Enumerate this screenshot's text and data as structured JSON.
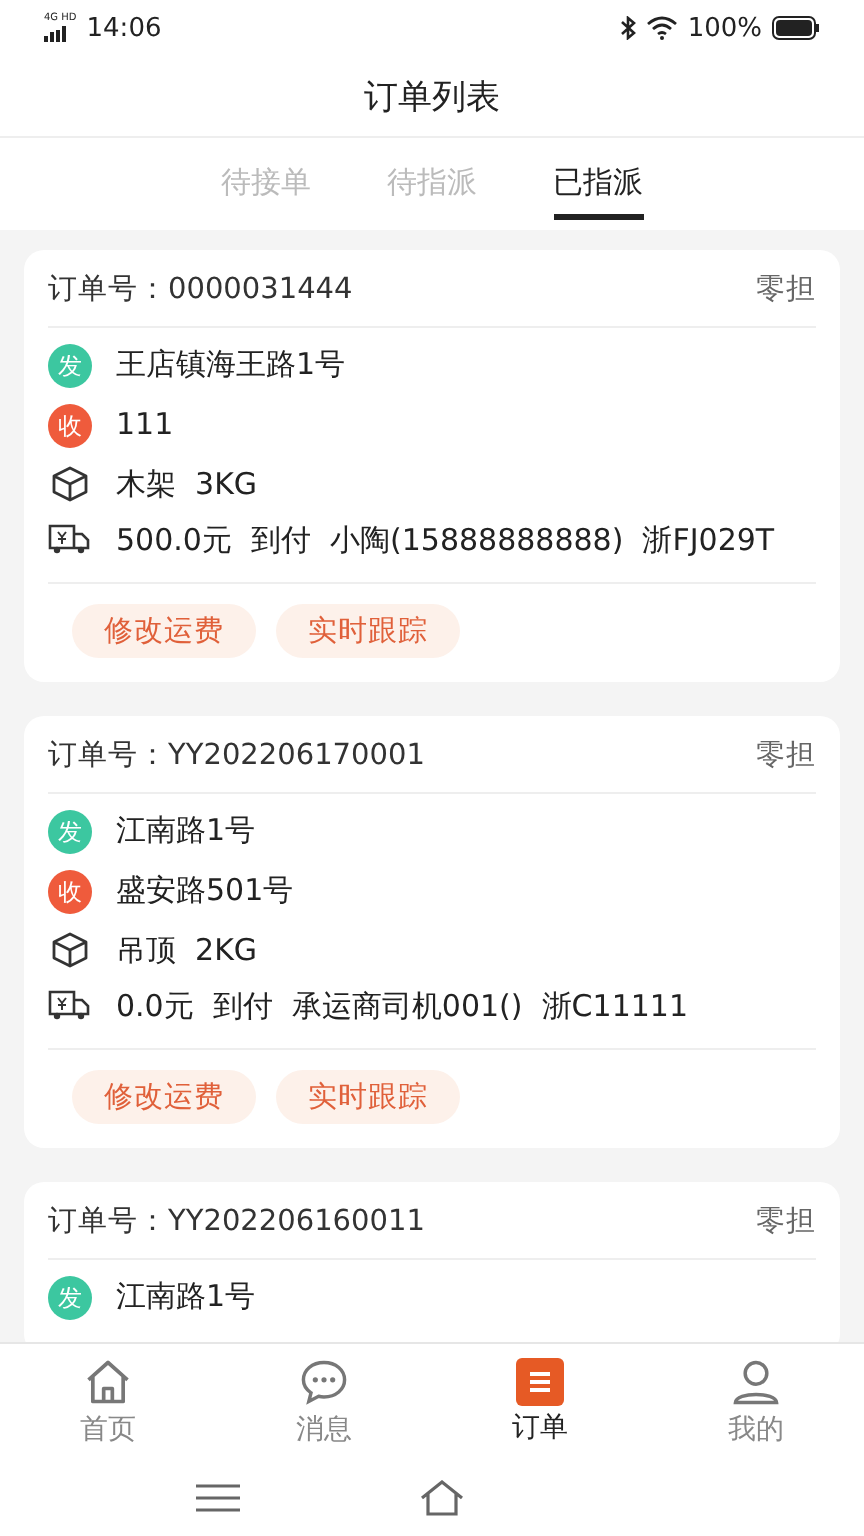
{
  "status_bar": {
    "network": "4G HD",
    "time": "14:06",
    "battery": "100%"
  },
  "header": {
    "title": "订单列表"
  },
  "tabs": [
    {
      "label": "待接单",
      "selected": false
    },
    {
      "label": "待指派",
      "selected": false
    },
    {
      "label": "已指派",
      "selected": true
    }
  ],
  "orders": [
    {
      "order_label": "订单号：",
      "order_no": "0000031444",
      "type": "零担",
      "rows": [
        {
          "kind": "sender",
          "badge": "发",
          "text": "王店镇海王路1号"
        },
        {
          "kind": "receiver",
          "badge": "收",
          "text": "111"
        },
        {
          "kind": "goods",
          "text": "木架  3KG"
        },
        {
          "kind": "freight",
          "text": "500.0元  到付  小陶(15888888888)  浙FJ029T"
        }
      ],
      "buttons": [
        "修改运费",
        "实时跟踪"
      ]
    },
    {
      "order_label": "订单号：",
      "order_no": "YY202206170001",
      "type": "零担",
      "rows": [
        {
          "kind": "sender",
          "badge": "发",
          "text": "江南路1号"
        },
        {
          "kind": "receiver",
          "badge": "收",
          "text": "盛安路501号"
        },
        {
          "kind": "goods",
          "text": "吊顶  2KG"
        },
        {
          "kind": "freight",
          "text": "0.0元  到付  承运商司机001()  浙C11111"
        }
      ],
      "buttons": [
        "修改运费",
        "实时跟踪"
      ]
    },
    {
      "order_label": "订单号：",
      "order_no": "YY202206160011",
      "type": "零担",
      "rows": [
        {
          "kind": "sender",
          "badge": "发",
          "text": "江南路1号"
        }
      ]
    }
  ],
  "bottom_nav": [
    {
      "kind": "home",
      "label": "首页",
      "selected": false
    },
    {
      "kind": "message",
      "label": "消息",
      "selected": false
    },
    {
      "kind": "orders",
      "label": "订单",
      "selected": true
    },
    {
      "kind": "profile",
      "label": "我的",
      "selected": false
    }
  ]
}
